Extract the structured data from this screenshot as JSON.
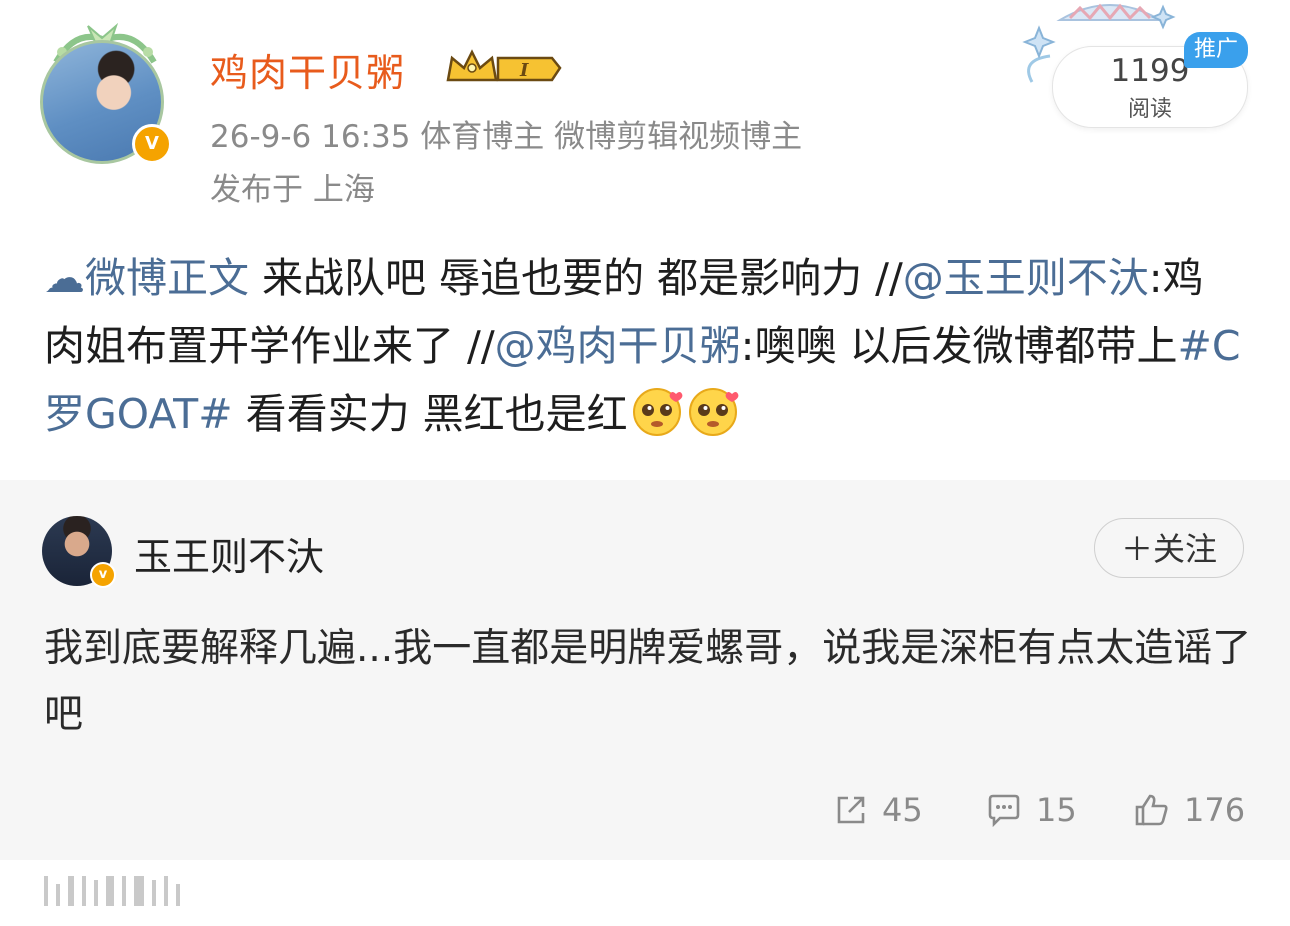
{
  "author": {
    "name": "鸡肉干贝粥",
    "meta_line1": "26-9-6 16:35  体育博主 微博剪辑视频博主",
    "meta_line2": "发布于 上海",
    "verified_badge": "V",
    "crown_level": "I"
  },
  "read_counter": {
    "count": "1199",
    "label": "阅读",
    "promo_tag": "推广"
  },
  "post": {
    "topic_icon": "☁",
    "topic_link": "微博正文",
    "text_a": " 来战队吧 辱追也要的 都是影响力 //",
    "mention_1": "@玉王则不汏",
    "text_b": ":鸡肉姐布置开学作业来了 //",
    "mention_2": "@鸡肉干贝粥",
    "text_c": ":噢噢 以后发微博都带上",
    "hashtag": "#C罗GOAT#",
    "text_d": " 看看实力 黑红也是红"
  },
  "original": {
    "author_name": "玉王则不汏",
    "follow_label": "＋关注",
    "text": "我到底要解释几遍...我一直都是明牌爱螺哥，说我是深柜有点太造谣了吧"
  },
  "stats": {
    "reposts": "45",
    "comments": "15",
    "likes": "176"
  },
  "colors": {
    "username": "#e85b1c",
    "link": "#4b6d95",
    "promo": "#3aa0ec",
    "badge": "#f5a300"
  }
}
